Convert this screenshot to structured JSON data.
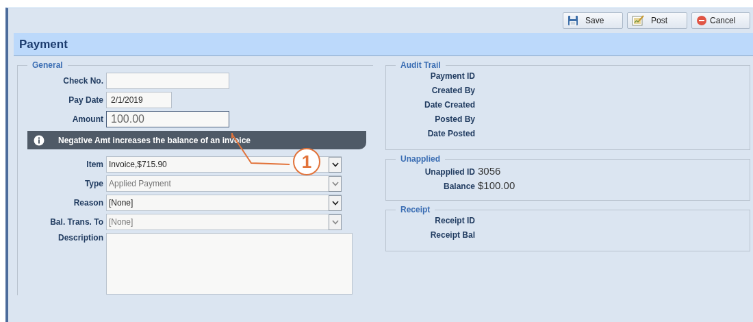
{
  "toolbar": {
    "buttons": [
      {
        "kind": "save",
        "label": "Save"
      },
      {
        "kind": "post",
        "label": "Post"
      },
      {
        "kind": "cancel",
        "label": "Cancel"
      }
    ]
  },
  "header": {
    "title": "Payment"
  },
  "general": {
    "title": "General",
    "fields": [
      {
        "kind": "text",
        "label": "Check No."
      },
      {
        "kind": "date",
        "label": "Pay Date",
        "value": "2/1/2019"
      },
      {
        "kind": "amount",
        "label": "Amount",
        "value": "100.00",
        "focused": true
      },
      {
        "kind": "info",
        "text": "Negative Amt increases the balance of an invoice"
      },
      {
        "kind": "select",
        "label": "Item",
        "value": "Invoice,$715.90",
        "disabled": false
      },
      {
        "kind": "select",
        "label": "Type",
        "value": "Applied Payment",
        "disabled": true
      },
      {
        "kind": "select",
        "label": "Reason",
        "value": "[None]",
        "disabled": false
      },
      {
        "kind": "select",
        "label": "Bal. Trans. To",
        "value": "[None]",
        "disabled": true
      },
      {
        "kind": "textarea",
        "label": "Description"
      }
    ]
  },
  "right_sections": [
    {
      "title": "Audit Trail",
      "rows": [
        {
          "label": "Payment ID"
        },
        {
          "label": "Created By"
        },
        {
          "label": "Date Created"
        },
        {
          "label": "Posted By"
        },
        {
          "label": "Date Posted"
        }
      ]
    },
    {
      "title": "Unapplied",
      "rows": [
        {
          "label": "Unapplied ID",
          "value": "3056"
        },
        {
          "label": "Balance",
          "value": "$100.00"
        }
      ]
    },
    {
      "title": "Receipt",
      "rows": [
        {
          "label": "Receipt ID"
        },
        {
          "label": "Receipt Bal"
        }
      ]
    }
  ],
  "callout": {
    "label": "1"
  }
}
